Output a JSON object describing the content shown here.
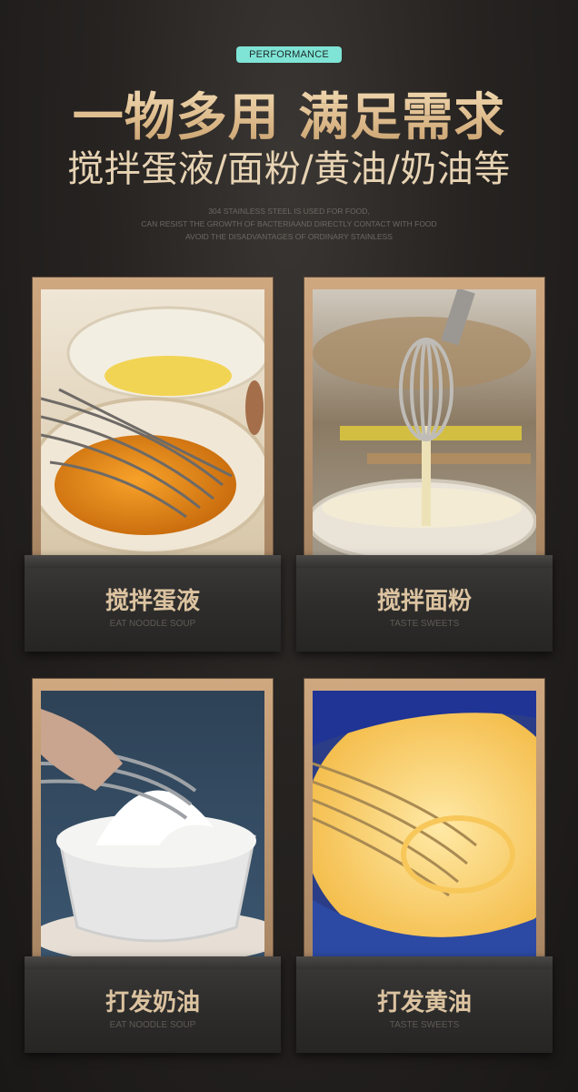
{
  "header": {
    "badge": "PERFORMANCE",
    "title": "一物多用 满足需求",
    "subtitle": "搅拌蛋液/面粉/黄油/奶油等",
    "english_lines": [
      "304 STAINLESS STEEL IS USED FOR FOOD,",
      "CAN RESIST THE GROWTH OF BACTERIAAND DIRECTLY CONTACT WITH FOOD",
      "AVOID THE DISADVANTAGES OF ORDINARY STAINLESS"
    ]
  },
  "cards": [
    {
      "label": "搅拌蛋液",
      "sub": "EAT NOODLE SOUP",
      "photo": "egg-whisk-photo"
    },
    {
      "label": "搅拌面粉",
      "sub": "TASTE SWEETS",
      "photo": "batter-whisk-photo"
    },
    {
      "label": "打发奶油",
      "sub": "EAT NOODLE SOUP",
      "photo": "cream-whisk-photo"
    },
    {
      "label": "打发黄油",
      "sub": "TASTE SWEETS",
      "photo": "butter-whisk-photo"
    }
  ],
  "colors": {
    "badge": "#7fe4d6",
    "gold_text": "#e7d3b3",
    "frame": "#b8926b",
    "background": "#262321"
  }
}
